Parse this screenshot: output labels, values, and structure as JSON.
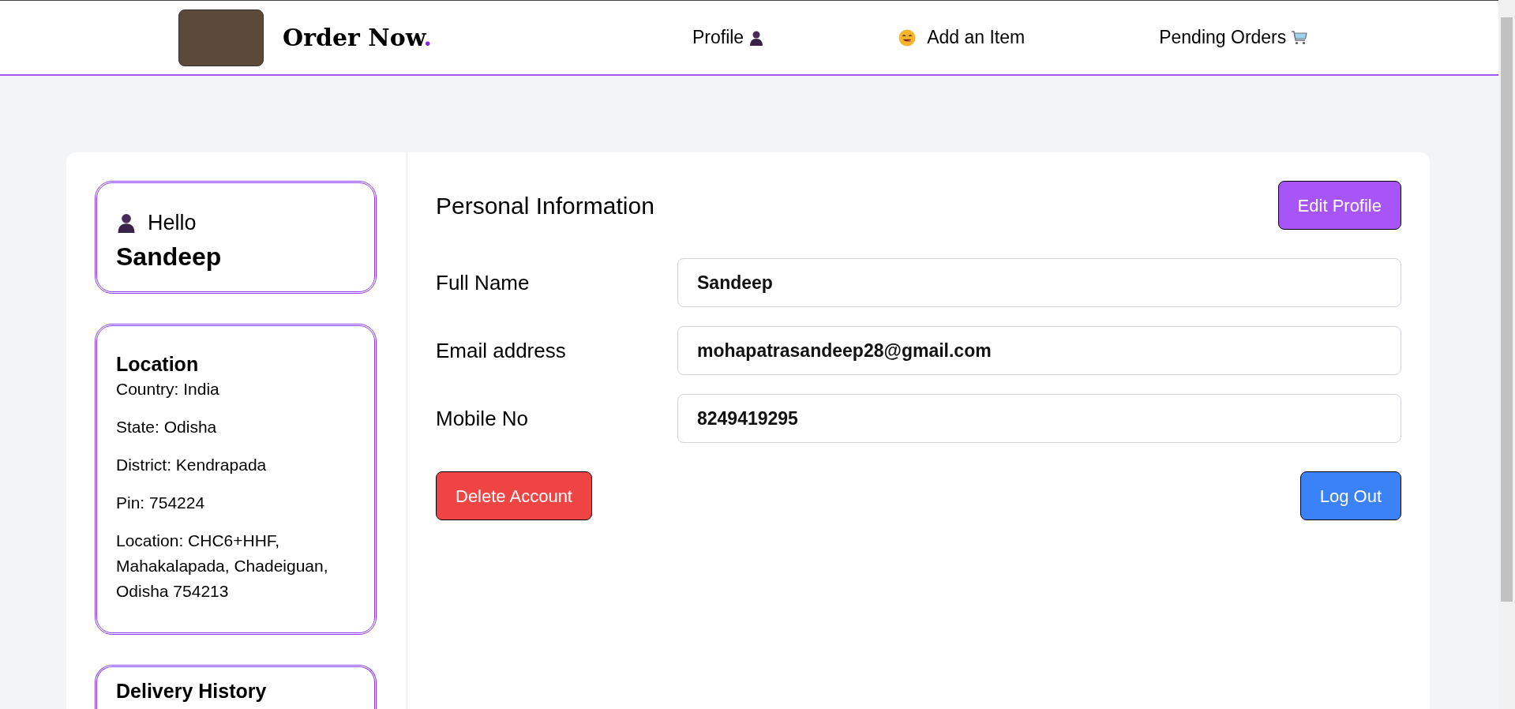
{
  "navbar": {
    "brand": {
      "title": "Order Now",
      "dot": "."
    },
    "links": [
      {
        "label": "Profile",
        "kind": "profile"
      },
      {
        "label": "Add an Item",
        "kind": "add"
      },
      {
        "label": "Pending Orders",
        "kind": "orders"
      }
    ]
  },
  "greeting": {
    "hello": "Hello",
    "name": "Sandeep"
  },
  "location": {
    "heading": "Location",
    "lines": [
      "Country: India",
      "State: Odisha",
      "District: Kendrapada",
      "Pin: 754224",
      "Location: CHC6+HHF, Mahakalapada, Chadeiguan, Odisha 754213"
    ]
  },
  "delivery_history": {
    "heading": "Delivery History"
  },
  "personal_info": {
    "heading": "Personal Information",
    "edit_button": "Edit Profile",
    "fields": [
      {
        "label": "Full Name",
        "value": "Sandeep"
      },
      {
        "label": "Email address",
        "value": "mohapatrasandeep28@gmail.com"
      },
      {
        "label": "Mobile No",
        "value": "8249419295"
      }
    ],
    "delete_button": "Delete Account",
    "logout_button": "Log Out"
  }
}
